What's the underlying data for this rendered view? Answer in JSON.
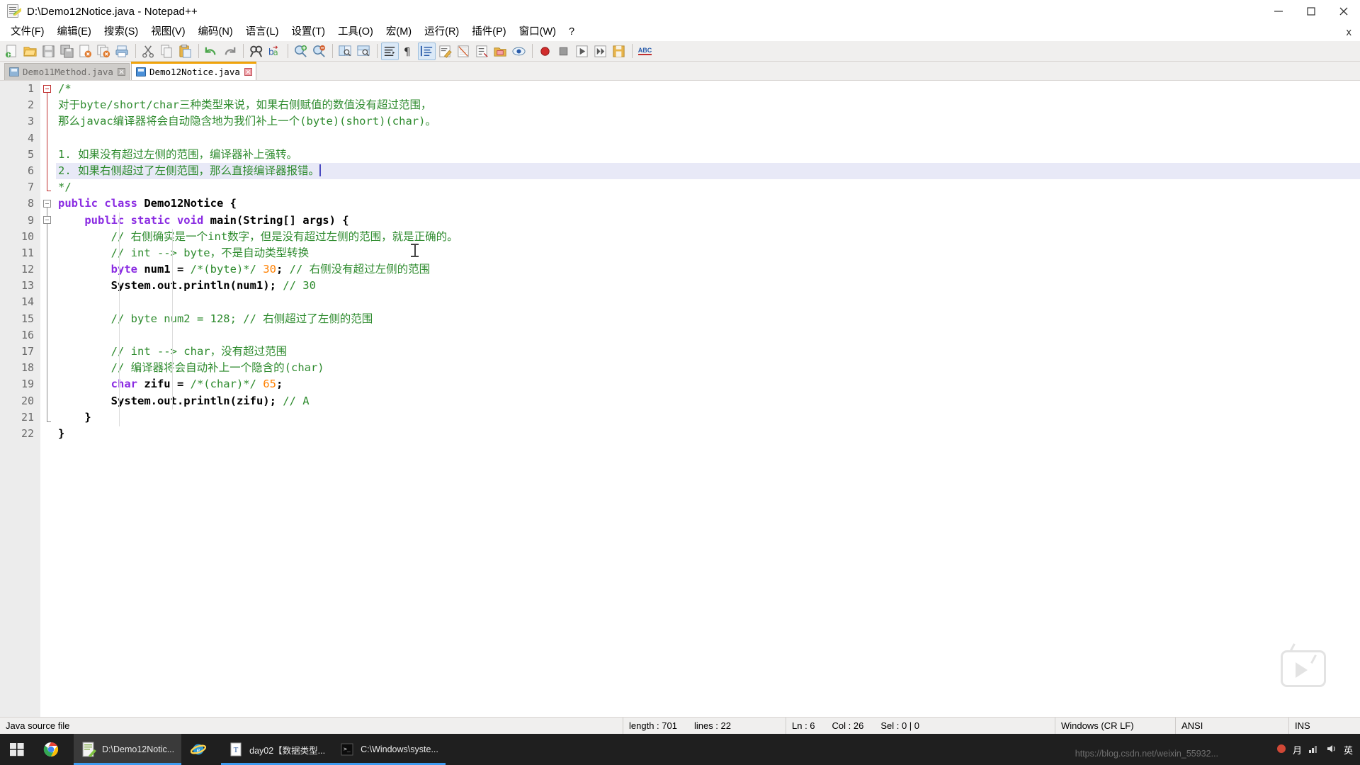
{
  "window": {
    "title": "D:\\Demo12Notice.java - Notepad++",
    "app_icon": "notepad-plus-plus-icon",
    "minimize": "—",
    "maximize": "❑",
    "close": "✕"
  },
  "menu": {
    "items": [
      {
        "label": "文件(F)"
      },
      {
        "label": "编辑(E)"
      },
      {
        "label": "搜索(S)"
      },
      {
        "label": "视图(V)"
      },
      {
        "label": "编码(N)"
      },
      {
        "label": "语言(L)"
      },
      {
        "label": "设置(T)"
      },
      {
        "label": "工具(O)"
      },
      {
        "label": "宏(M)"
      },
      {
        "label": "运行(R)"
      },
      {
        "label": "插件(P)"
      },
      {
        "label": "窗口(W)"
      },
      {
        "label": "?"
      }
    ],
    "close_document": "x"
  },
  "toolbar": {
    "buttons": [
      {
        "name": "new-file-icon"
      },
      {
        "name": "open-file-icon"
      },
      {
        "name": "save-icon"
      },
      {
        "name": "save-all-icon"
      },
      {
        "name": "close-file-icon"
      },
      {
        "name": "close-all-files-icon"
      },
      {
        "name": "print-icon"
      },
      {
        "sep": true
      },
      {
        "name": "cut-icon"
      },
      {
        "name": "copy-icon"
      },
      {
        "name": "paste-icon"
      },
      {
        "sep": true
      },
      {
        "name": "undo-icon"
      },
      {
        "name": "redo-icon"
      },
      {
        "sep": true
      },
      {
        "name": "find-icon"
      },
      {
        "name": "replace-icon"
      },
      {
        "sep": true
      },
      {
        "name": "zoom-in-icon"
      },
      {
        "name": "zoom-out-icon"
      },
      {
        "sep": true
      },
      {
        "name": "sync-vertical-scroll-icon"
      },
      {
        "name": "sync-horizontal-scroll-icon"
      },
      {
        "sep": true
      },
      {
        "name": "word-wrap-icon",
        "active": true
      },
      {
        "name": "show-all-characters-icon"
      },
      {
        "name": "indent-guideline-icon",
        "active": true
      },
      {
        "name": "user-defined-language-icon"
      },
      {
        "name": "document-map-icon"
      },
      {
        "name": "function-list-icon"
      },
      {
        "name": "folder-as-workspace-icon"
      },
      {
        "name": "monitoring-icon"
      },
      {
        "sep": true
      },
      {
        "name": "macro-record-icon"
      },
      {
        "name": "macro-stop-icon"
      },
      {
        "name": "macro-play-icon"
      },
      {
        "name": "macro-play-multiple-icon"
      },
      {
        "name": "macro-save-icon"
      },
      {
        "sep": true
      },
      {
        "name": "spell-check-icon",
        "label": "ABC"
      }
    ]
  },
  "tabs": [
    {
      "label": "Demo11Method.java",
      "active": false
    },
    {
      "label": "Demo12Notice.java",
      "active": true
    }
  ],
  "editor": {
    "total_lines": 22,
    "current_line": 6,
    "lines": [
      {
        "n": 1,
        "tokens": [
          {
            "t": "/*",
            "c": "cm"
          }
        ]
      },
      {
        "n": 2,
        "tokens": [
          {
            "t": "对于byte/short/char三种类型来说，如果右侧赋值的数值没有超过范围，",
            "c": "cm"
          }
        ]
      },
      {
        "n": 3,
        "tokens": [
          {
            "t": "那么javac编译器将会自动隐含地为我们补上一个(byte)(short)(char)。",
            "c": "cm"
          }
        ]
      },
      {
        "n": 4,
        "tokens": []
      },
      {
        "n": 5,
        "tokens": [
          {
            "t": "1. 如果没有超过左侧的范围，编译器补上强转。",
            "c": "cm"
          }
        ]
      },
      {
        "n": 6,
        "tokens": [
          {
            "t": "2. 如果右侧超过了左侧范围，那么直接编译器报错。",
            "c": "cm"
          }
        ],
        "highlight": true,
        "caret": true
      },
      {
        "n": 7,
        "tokens": [
          {
            "t": "*/",
            "c": "cm"
          }
        ]
      },
      {
        "n": 8,
        "tokens": [
          {
            "t": "public class ",
            "c": "k"
          },
          {
            "t": "Demo12Notice ",
            "c": "op"
          },
          {
            "t": "{",
            "c": "op"
          }
        ]
      },
      {
        "n": 9,
        "tokens": [
          {
            "t": "    ",
            "c": "op"
          },
          {
            "t": "public static void ",
            "c": "k"
          },
          {
            "t": "main(String[] args) {",
            "c": "op"
          }
        ]
      },
      {
        "n": 10,
        "tokens": [
          {
            "t": "        // 右侧确实是一个int数字，但是没有超过左侧的范围，就是正确的。",
            "c": "cm"
          }
        ]
      },
      {
        "n": 11,
        "tokens": [
          {
            "t": "        // int --> byte，不是自动类型转换",
            "c": "cm"
          }
        ]
      },
      {
        "n": 12,
        "tokens": [
          {
            "t": "        ",
            "c": "op"
          },
          {
            "t": "byte",
            "c": "k"
          },
          {
            "t": " num1 = ",
            "c": "op"
          },
          {
            "t": "/*(byte)*/ ",
            "c": "cm"
          },
          {
            "t": "30",
            "c": "nu"
          },
          {
            "t": "; ",
            "c": "op"
          },
          {
            "t": "// 右侧没有超过左侧的范围",
            "c": "cm"
          }
        ]
      },
      {
        "n": 13,
        "tokens": [
          {
            "t": "        System.out.println(num1); ",
            "c": "op"
          },
          {
            "t": "// 30",
            "c": "cm"
          }
        ]
      },
      {
        "n": 14,
        "tokens": []
      },
      {
        "n": 15,
        "tokens": [
          {
            "t": "        // byte num2 = 128; // 右侧超过了左侧的范围",
            "c": "cm"
          }
        ]
      },
      {
        "n": 16,
        "tokens": []
      },
      {
        "n": 17,
        "tokens": [
          {
            "t": "        // int --> char，没有超过范围",
            "c": "cm"
          }
        ]
      },
      {
        "n": 18,
        "tokens": [
          {
            "t": "        // 编译器将会自动补上一个隐含的(char)",
            "c": "cm"
          }
        ]
      },
      {
        "n": 19,
        "tokens": [
          {
            "t": "        ",
            "c": "op"
          },
          {
            "t": "char",
            "c": "k"
          },
          {
            "t": " zifu = ",
            "c": "op"
          },
          {
            "t": "/*(char)*/ ",
            "c": "cm"
          },
          {
            "t": "65",
            "c": "nu"
          },
          {
            "t": ";",
            "c": "op"
          }
        ]
      },
      {
        "n": 20,
        "tokens": [
          {
            "t": "        System.out.println(zifu); ",
            "c": "op"
          },
          {
            "t": "// A",
            "c": "cm"
          }
        ]
      },
      {
        "n": 21,
        "tokens": [
          {
            "t": "    }",
            "c": "op"
          }
        ]
      },
      {
        "n": 22,
        "tokens": [
          {
            "t": "}",
            "c": "op"
          }
        ]
      }
    ],
    "colors": {
      "comment": "#2e8b2e",
      "keyword": "#8a2be2",
      "number": "#ff8000",
      "text": "#000000",
      "current_line_bg": "#e8e9f7"
    }
  },
  "statusbar": {
    "doc_type": "Java source file",
    "length_label": "length : 701",
    "lines_label": "lines : 22",
    "ln": "Ln : 6",
    "col": "Col : 26",
    "sel": "Sel : 0 | 0",
    "eol": "Windows (CR LF)",
    "encoding": "ANSI",
    "insert_mode": "INS"
  },
  "taskbar": {
    "start": "windows-start-icon",
    "apps": [
      {
        "name": "chrome-taskbar-icon",
        "label": "",
        "pinned": true,
        "active": false
      },
      {
        "name": "notepad-plus-plus-taskbar-item",
        "label": "D:\\Demo12Notic...",
        "pinned": false,
        "active": true
      },
      {
        "name": "internet-explorer-taskbar-icon",
        "label": "",
        "pinned": true,
        "active": false
      },
      {
        "name": "word-document-taskbar-item",
        "label": "day02【数据类型...",
        "pinned": false,
        "active": false
      },
      {
        "name": "command-prompt-taskbar-item",
        "label": "C:\\Windows\\syste...",
        "pinned": false,
        "active": false
      }
    ],
    "watermark": "https://blog.csdn.net/weixin_55932...",
    "tray": {
      "volume": "volume-icon",
      "network": "network-icon",
      "ime": "英",
      "extra": "月"
    }
  }
}
